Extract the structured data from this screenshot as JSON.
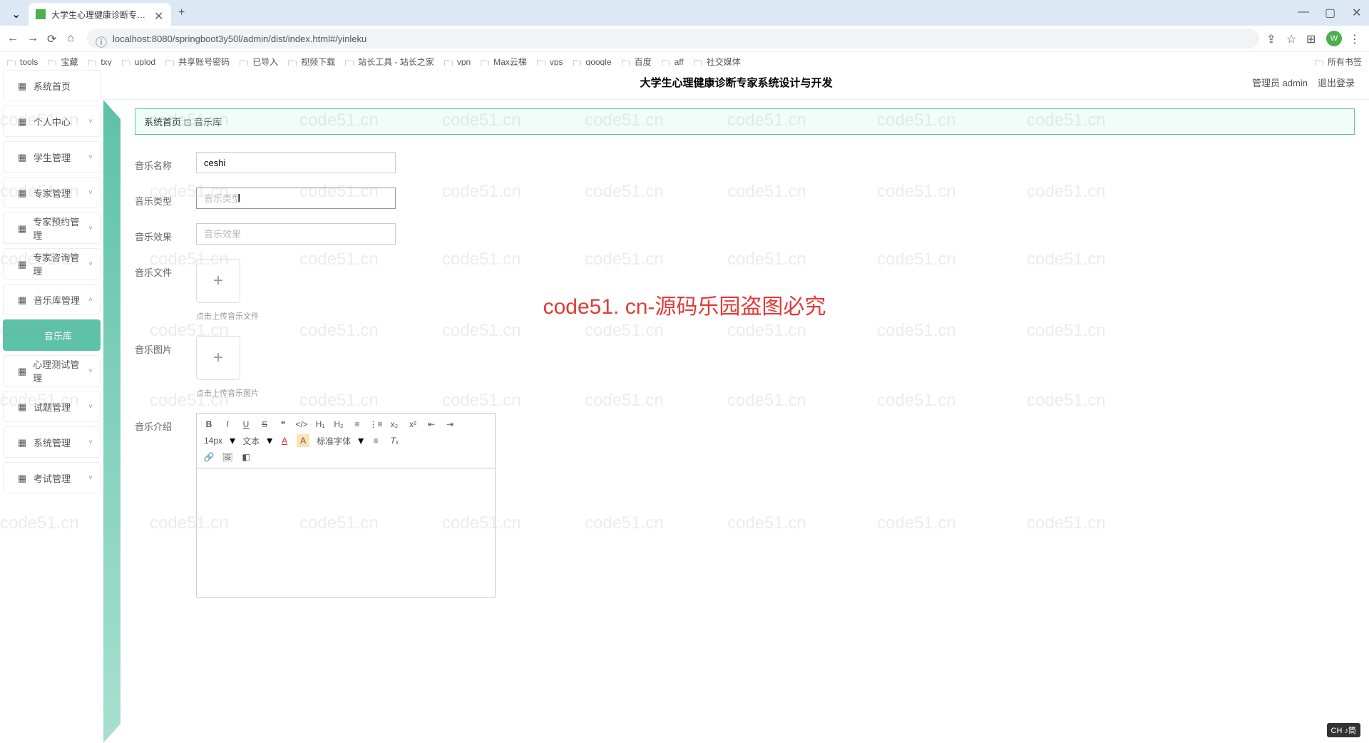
{
  "browser": {
    "tab_title": "大学生心理健康诊断专家系统",
    "url": "localhost:8080/springboot3y50l/admin/dist/index.html#/yinleku",
    "profile_letter": "W"
  },
  "bookmarks": [
    {
      "label": "tools",
      "icon": "folder"
    },
    {
      "label": "宝藏",
      "icon": "folder"
    },
    {
      "label": "txy",
      "icon": "cloud"
    },
    {
      "label": "uplod",
      "icon": "play"
    },
    {
      "label": "共享账号密码",
      "icon": "sheet"
    },
    {
      "label": "已导入",
      "icon": "folder"
    },
    {
      "label": "视频下载",
      "icon": "video"
    },
    {
      "label": "站长工具 - 站长之家",
      "icon": "logo"
    },
    {
      "label": "vpn",
      "icon": "folder"
    },
    {
      "label": "Max云梯",
      "icon": "folder"
    },
    {
      "label": "vps",
      "icon": "folder"
    },
    {
      "label": "google",
      "icon": "folder"
    },
    {
      "label": "百度",
      "icon": "baidu"
    },
    {
      "label": "aff",
      "icon": "folder"
    },
    {
      "label": "社交媒体",
      "icon": "folder"
    }
  ],
  "bookmark_right": "所有书签",
  "header": {
    "title": "大学生心理健康诊断专家系统设计与开发",
    "role": "管理员 admin",
    "logout": "退出登录"
  },
  "sidebar": [
    {
      "label": "系统首页",
      "icon": "home",
      "expand": false
    },
    {
      "label": "个人中心",
      "icon": "user",
      "expand": true
    },
    {
      "label": "学生管理",
      "icon": "grid",
      "expand": true
    },
    {
      "label": "专家管理",
      "icon": "monitor",
      "expand": true
    },
    {
      "label": "专家预约管理",
      "icon": "calendar",
      "expand": true
    },
    {
      "label": "专家咨询管理",
      "icon": "grid",
      "expand": true
    },
    {
      "label": "音乐库管理",
      "icon": "music",
      "expand": true,
      "expanded": true
    },
    {
      "label": "音乐库",
      "sub": true,
      "active": true
    },
    {
      "label": "心理测试管理",
      "icon": "grid",
      "expand": true
    },
    {
      "label": "试题管理",
      "icon": "list",
      "expand": true
    },
    {
      "label": "系统管理",
      "icon": "grid",
      "expand": true
    },
    {
      "label": "考试管理",
      "icon": "grid",
      "expand": true
    }
  ],
  "breadcrumb": {
    "home": "系统首页",
    "sep": "⊡",
    "current": "音乐库"
  },
  "form": {
    "name_label": "音乐名称",
    "name_value": "ceshi",
    "type_label": "音乐类型",
    "type_placeholder": "音乐类型",
    "effect_label": "音乐效果",
    "effect_placeholder": "音乐效果",
    "file_label": "音乐文件",
    "file_hint": "点击上传音乐文件",
    "image_label": "音乐图片",
    "image_hint": "点击上传音乐图片",
    "intro_label": "音乐介绍"
  },
  "editor": {
    "font_size": "14px",
    "text_type": "文本",
    "font_family": "标准字体"
  },
  "watermark": "code51. cn-源码乐园盗图必究",
  "watermark_bg": "code51.cn",
  "ime": "CH ♪筒"
}
